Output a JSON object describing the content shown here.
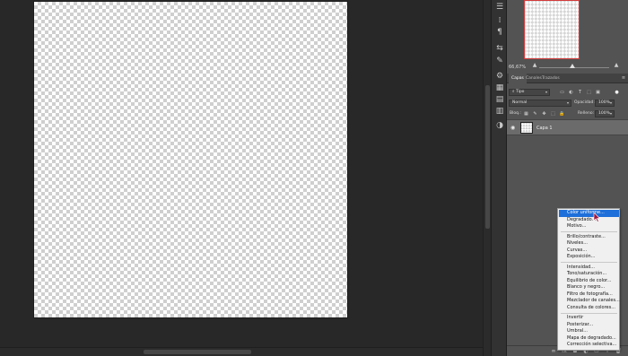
{
  "navigator": {
    "zoom": "66,67%"
  },
  "panel": {
    "tabs": [
      "Capas",
      "Canales",
      "Trazados"
    ],
    "filter_kind": "Tipo",
    "blend_mode": "Normal",
    "opacity_label": "Opacidad:",
    "opacity_value": "100%",
    "lock_label": "Bloq.:",
    "fill_label": "Relleno:",
    "fill_value": "100%",
    "layer_name": "Capa 1"
  },
  "menu": {
    "groups": [
      [
        "Color uniforme...",
        "Degradado...",
        "Motivo..."
      ],
      [
        "Brillo/contraste...",
        "Niveles...",
        "Curvas...",
        "Exposición..."
      ],
      [
        "Intensidad...",
        "Tono/saturación...",
        "Equilibrio de color...",
        "Blanco y negro...",
        "Filtro de fotografía...",
        "Mezclador de canales...",
        "Consulta de colores..."
      ],
      [
        "Invertir",
        "Posterizar...",
        "Umbral...",
        "Mapa de degradado...",
        "Corrección selectiva..."
      ]
    ],
    "highlighted": "Color uniforme..."
  },
  "colors": {
    "highlight": "#1e6fd9",
    "workspace": "#282828",
    "panel": "#535353"
  }
}
